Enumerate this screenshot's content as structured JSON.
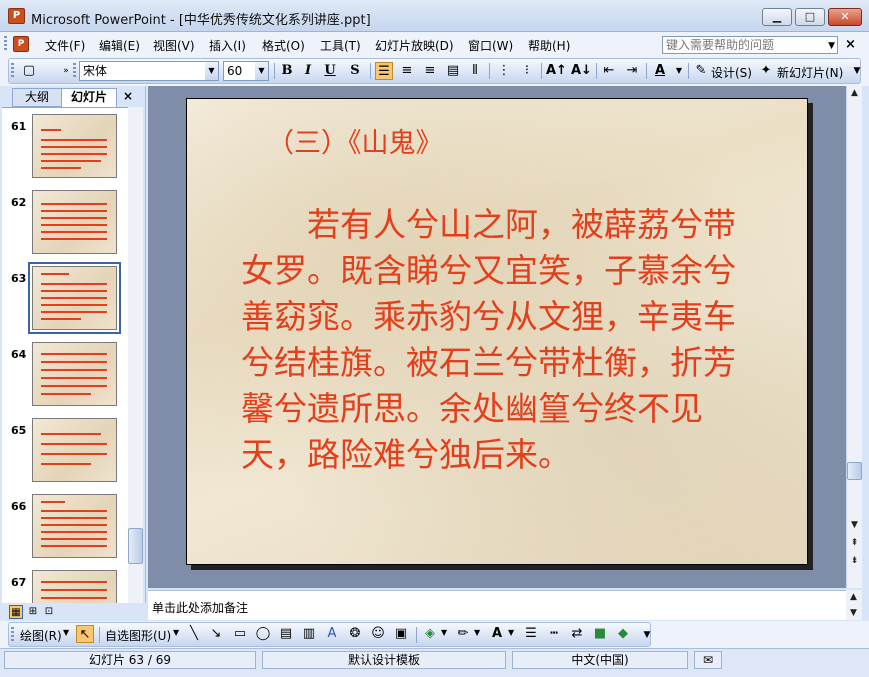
{
  "window": {
    "title": "Microsoft PowerPoint - [中华优秀传统文化系列讲座.ppt]",
    "app_icon_glyph": "P",
    "minimize_glyph": "▁",
    "maximize_glyph": "□",
    "close_glyph": "✕"
  },
  "menubar": {
    "items": [
      "文件(F)",
      "编辑(E)",
      "视图(V)",
      "插入(I)",
      "格式(O)",
      "工具(T)",
      "幻灯片放映(D)",
      "窗口(W)",
      "帮助(H)"
    ],
    "help_placeholder": "键入需要帮助的问题",
    "close_glyph": "×"
  },
  "toolbar": {
    "font_name": "宋体",
    "font_size": "60",
    "bold": "B",
    "italic": "I",
    "underline": "U",
    "shadow": "S",
    "design_label": "设计(S)",
    "new_slide_label": "新幻灯片(N)",
    "font_color_letter": "A"
  },
  "left_panel": {
    "tabs": [
      "大纲",
      "幻灯片"
    ],
    "close_glyph": "×",
    "thumbnails": [
      {
        "num": "61",
        "selected": false
      },
      {
        "num": "62",
        "selected": false
      },
      {
        "num": "63",
        "selected": true
      },
      {
        "num": "64",
        "selected": false
      },
      {
        "num": "65",
        "selected": false
      },
      {
        "num": "66",
        "selected": false
      },
      {
        "num": "67",
        "selected": false
      }
    ]
  },
  "slide": {
    "title": "（三）《山鬼》",
    "body": "　　若有人兮山之阿，被薜荔兮带女罗。既含睇兮又宜笑，子慕余兮善窈窕。乘赤豹兮从文狸，辛夷车兮结桂旗。被石兰兮带杜衡，折芳馨兮遗所思。余处幽篁兮终不见天，路险难兮独后来。",
    "text_color": "#e2401c"
  },
  "notes": {
    "placeholder": "单击此处添加备注"
  },
  "drawbar": {
    "draw_label": "绘图(R)",
    "autoshapes_label": "自选图形(U)"
  },
  "statusbar": {
    "slide_position": "幻灯片 63 / 69",
    "template": "默认设计模板",
    "language": "中文(中国)"
  }
}
